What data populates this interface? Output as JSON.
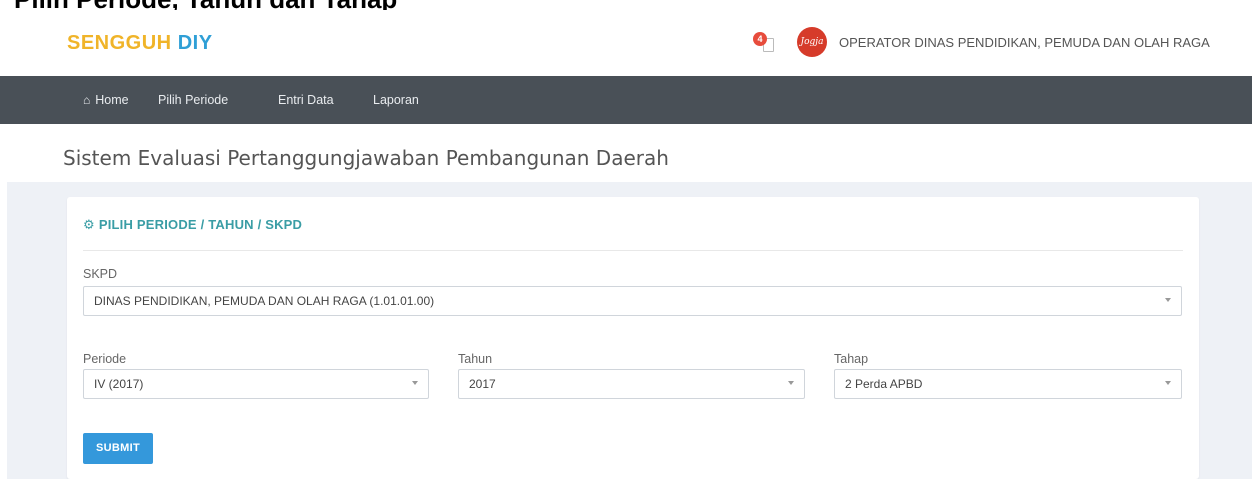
{
  "top_cut_text": "Pilih Periode, Tahun dan Tahap",
  "brand": {
    "part1": "SENGGUH",
    "part2": "DIY"
  },
  "notifications": {
    "count": "4"
  },
  "user": {
    "logo_text": "Jogja",
    "name": "OPERATOR DINAS PENDIDIKAN, PEMUDA DAN OLAH RAGA"
  },
  "nav": {
    "items": [
      {
        "label": "Home",
        "icon": "home-icon"
      },
      {
        "label": "Pilih Periode"
      },
      {
        "label": "Entri Data"
      },
      {
        "label": "Laporan"
      }
    ]
  },
  "page": {
    "title": "Sistem Evaluasi Pertanggungjawaban Pembangunan Daerah"
  },
  "panel": {
    "title": "PILIH PERIODE / TAHUN / SKPD",
    "icon": "gear-icon",
    "skpd": {
      "label": "SKPD",
      "value": "DINAS PENDIDIKAN, PEMUDA DAN OLAH RAGA (1.01.01.00)"
    },
    "periode": {
      "label": "Periode",
      "value": "IV (2017)"
    },
    "tahun": {
      "label": "Tahun",
      "value": "2017"
    },
    "tahap": {
      "label": "Tahap",
      "value": "2 Perda APBD"
    },
    "submit_label": "SUBMIT"
  },
  "colors": {
    "brand_yellow": "#f0b429",
    "brand_blue": "#2f9fd6",
    "navbar": "#495057",
    "panel_title": "#3a9da5",
    "submit": "#3498db",
    "badge": "#e74c3c"
  }
}
